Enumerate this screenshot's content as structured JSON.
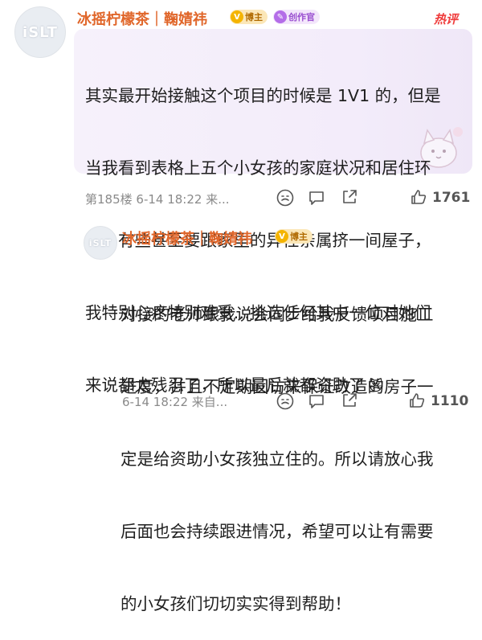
{
  "comment1": {
    "avatar_text": "iSLT",
    "username": "冰摇柠檬茶｜鞠婧祎",
    "badges": [
      "博主",
      "创作官"
    ],
    "hot_label": "热评",
    "lines": [
      "其实最开始接触这个项目的时候是 1V1 的，但是",
      "当我看到表格上五个小女孩的家庭状况和居住环",
      "境，有些甚至要跟家里的异性亲属挤一间屋子，",
      "我特别心疼特别难受…挑选任何其中一位对她们",
      "来说都太残忍了，所以最后就都资助了"
    ],
    "emoji": "😿",
    "meta": "第185楼  6-14  18:22  来...",
    "like_count": "1761"
  },
  "comment2": {
    "avatar_text": "iSLT",
    "username": "冰摇柠檬茶｜鞠婧祎",
    "badges": [
      "博主"
    ],
    "lines": [
      "对接的老师跟我说会同步给我反馈项目施工",
      "进度，并且不定期回访来保证改造的房子一",
      "定是给资助小女孩独立住的。所以请放心我",
      "后面也会持续跟进情况，希望可以让有需要",
      "的小女孩们切切实实得到帮助！"
    ],
    "meta": "6-14  18:22  来自...",
    "like_count": "1110"
  },
  "colors": {
    "username": "#e0662a",
    "hot": "#ef3b3b",
    "bubble": "#f5eff9",
    "meta": "#8a8a8a"
  },
  "icons": [
    "emoji-icon",
    "comment-icon",
    "share-icon",
    "like-icon",
    "blogger-badge-icon",
    "creator-badge-icon",
    "hot-badge"
  ]
}
